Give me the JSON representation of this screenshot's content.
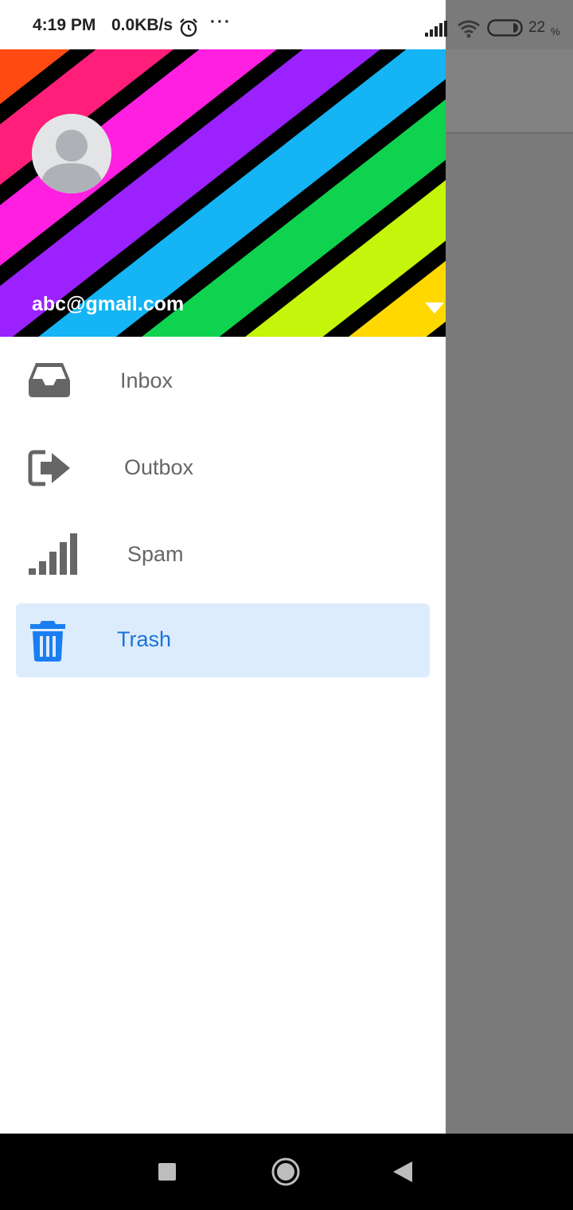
{
  "status_bar": {
    "time": "4:19 PM",
    "net_speed": "0.0KB/s",
    "more": "···",
    "battery_pct": "22",
    "battery_unit": "%"
  },
  "drawer": {
    "account_email": "abc@gmail.com",
    "items": [
      {
        "label": "Inbox",
        "icon": "inbox-icon",
        "active": false
      },
      {
        "label": "Outbox",
        "icon": "outbox-icon",
        "active": false
      },
      {
        "label": "Spam",
        "icon": "spam-icon",
        "active": false
      },
      {
        "label": "Trash",
        "icon": "trash-icon",
        "active": true
      }
    ]
  },
  "colors": {
    "active_bg": "#ddecfc",
    "active_text": "#1a73d9",
    "inactive_text": "#666666",
    "scrim": "#7a7a7a"
  }
}
